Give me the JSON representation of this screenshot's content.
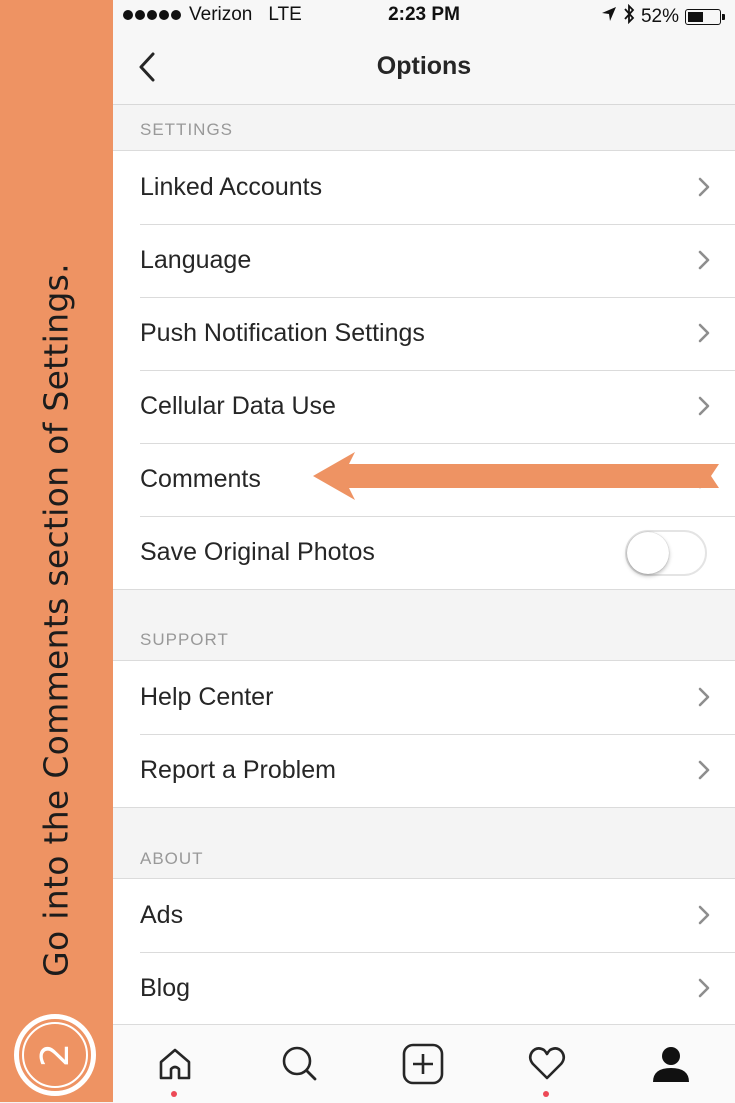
{
  "sidebar": {
    "instruction": "Go into the Comments section of Settings.",
    "step_number": "2"
  },
  "status_bar": {
    "carrier": "Verizon",
    "network": "LTE",
    "time": "2:23 PM",
    "battery": "52%",
    "battery_level": 0.52
  },
  "nav": {
    "title": "Options",
    "back_icon": "chevron-left-icon"
  },
  "sections": {
    "settings": {
      "header": "SETTINGS",
      "items": [
        {
          "label": "Linked Accounts"
        },
        {
          "label": "Language"
        },
        {
          "label": "Push Notification Settings"
        },
        {
          "label": "Cellular Data Use"
        },
        {
          "label": "Comments"
        },
        {
          "label": "Save Original Photos",
          "toggle_on": false
        }
      ]
    },
    "support": {
      "header": "SUPPORT",
      "items": [
        {
          "label": "Help Center"
        },
        {
          "label": "Report a Problem"
        }
      ]
    },
    "about": {
      "header": "ABOUT",
      "items": [
        {
          "label": "Ads"
        },
        {
          "label": "Blog"
        }
      ]
    }
  },
  "tab_bar": {
    "tabs": [
      {
        "icon": "home-icon",
        "notification_dot": true
      },
      {
        "icon": "search-icon",
        "notification_dot": false
      },
      {
        "icon": "add-post-icon",
        "notification_dot": false
      },
      {
        "icon": "heart-icon",
        "notification_dot": true
      },
      {
        "icon": "profile-icon",
        "notification_dot": false
      }
    ]
  },
  "colors": {
    "accent_orange": "#ee9363",
    "notification_dot": "#ed4956",
    "annotation_arrow": "#ee9363"
  }
}
